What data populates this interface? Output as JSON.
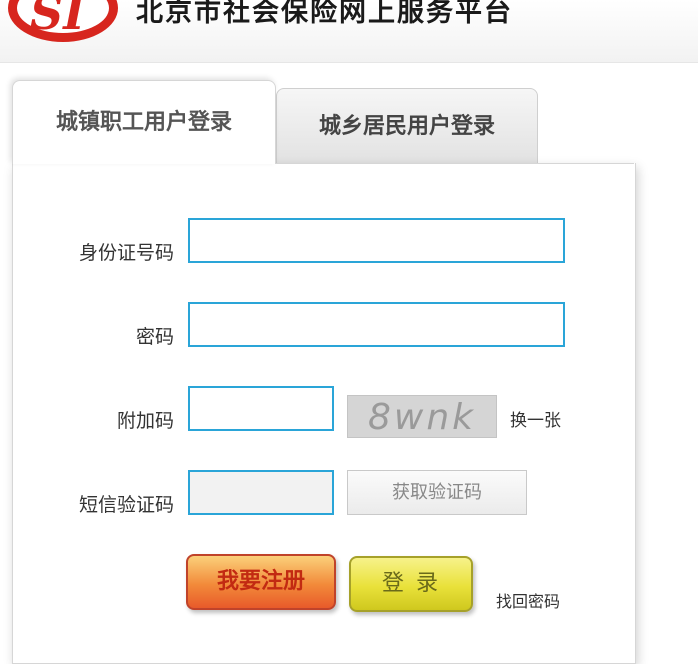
{
  "header": {
    "logo_text": "SI",
    "site_title": "北京市社会保险网上服务平台"
  },
  "tabs": [
    {
      "label": "城镇职工用户登录",
      "active": true
    },
    {
      "label": "城乡居民用户登录",
      "active": false
    }
  ],
  "form": {
    "id_label": "身份证号码",
    "id_value": "",
    "password_label": "密码",
    "password_value": "",
    "captcha_label": "附加码",
    "captcha_value": "",
    "captcha_text": "8wnk",
    "refresh_label": "换一张",
    "sms_label": "短信验证码",
    "sms_value": "",
    "sms_button": "获取验证码"
  },
  "actions": {
    "register": "我要注册",
    "login": "登录",
    "forgot": "找回密码"
  },
  "colors": {
    "field_border": "#2aa5d8",
    "logo_red": "#d7261e",
    "register_text": "#c22a12",
    "login_bg": "#e9e13a"
  }
}
